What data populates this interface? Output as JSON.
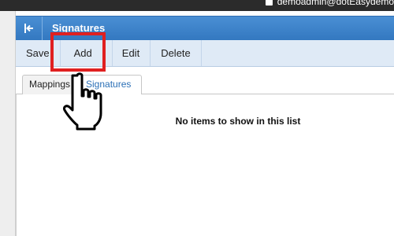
{
  "top_bar": {
    "user": "demoadmin@dotEasydemo"
  },
  "header": {
    "title": "Signatures",
    "collapse_icon": "collapse-left-icon"
  },
  "toolbar": {
    "save": "Save",
    "add": "Add",
    "edit": "Edit",
    "delete": "Delete"
  },
  "tabs": [
    {
      "label": "Mappings",
      "active": false
    },
    {
      "label": "Signatures",
      "active": true
    }
  ],
  "content": {
    "empty_message": "No items to show in this list"
  },
  "colors": {
    "header_blue": "#3a80c8",
    "toolbar_bg": "#dfeaf6",
    "highlight": "#e02020",
    "active_tab_text": "#2a6fb6"
  }
}
